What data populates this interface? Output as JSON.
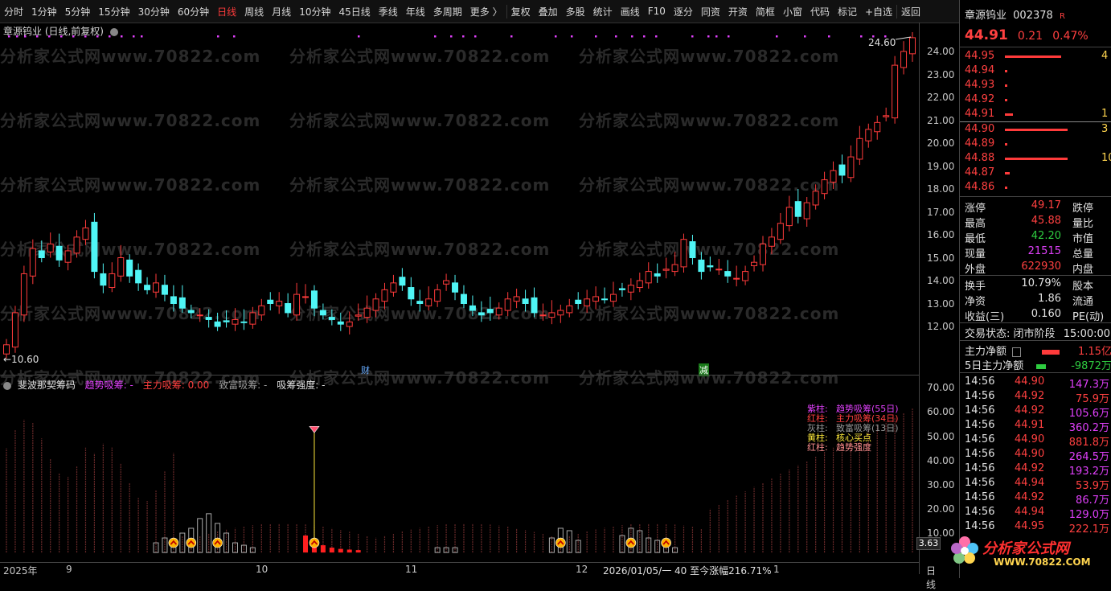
{
  "toolbar": {
    "items": [
      "分时",
      "1分钟",
      "5分钟",
      "15分钟",
      "30分钟",
      "60分钟",
      "日线",
      "周线",
      "月线",
      "10分钟",
      "45日线",
      "季线",
      "年线",
      "多周期",
      "更多 〉",
      "复权",
      "叠加",
      "多股",
      "统计",
      "画线",
      "F10",
      "逐分",
      "同资",
      "开资",
      "简框",
      "小窗",
      "代码",
      "标记",
      "+自选",
      "返回"
    ],
    "active": "日线"
  },
  "main": {
    "title": "章源钨业 (日线,前复权)",
    "high_label": "24.60",
    "low_label": "←10.60",
    "price_ticks": [
      "24.00",
      "23.00",
      "22.00",
      "21.00",
      "20.00",
      "19.00",
      "18.00",
      "17.00",
      "16.00",
      "15.00",
      "14.00",
      "13.00",
      "12.00"
    ],
    "marker_cai": "财",
    "marker_jian": "减",
    "watermark": "分析家公式网www.70822.com"
  },
  "osc": {
    "name": "斐波那契筹码",
    "f1_label": "趋势吸筹:",
    "f1_value": "-",
    "f2_label": "主力吸筹:",
    "f2_value": "0.00",
    "f3_label": "致富吸筹:",
    "f3_value": "-",
    "f4_label": "吸筹强度:",
    "f4_value": "-",
    "ticks": [
      "70.00",
      "60.00",
      "50.00",
      "40.00",
      "30.00",
      "20.00",
      "10.00"
    ],
    "value_box": "3.63",
    "legend": [
      {
        "k": "紫柱:",
        "v": "趋势吸筹(55日)",
        "color": "#e040fb"
      },
      {
        "k": "红柱:",
        "v": "主力吸筹(34日)",
        "color": "#ff4040"
      },
      {
        "k": "灰柱:",
        "v": "致富吸筹(13日)",
        "color": "#9a9a9a"
      },
      {
        "k": "黄柱:",
        "v": "核心买点",
        "color": "#ffeb3b"
      },
      {
        "k": "红柱:",
        "v": "趋势强度",
        "color": "#ff9090"
      }
    ]
  },
  "bottom_axis": {
    "labels": [
      "2025年",
      "9",
      "10",
      "11",
      "12",
      "1",
      "日线"
    ],
    "status": "2026/01/05/一  40  至今涨幅216.71%"
  },
  "panel": {
    "stock_name": "章源钨业",
    "code": "002378",
    "tag": "R",
    "price": "44.91",
    "change": "0.21",
    "change_pct": "0.47%",
    "asks": [
      {
        "p": "44.95",
        "v": "4"
      },
      {
        "p": "44.94",
        "v": ""
      },
      {
        "p": "44.93",
        "v": ""
      },
      {
        "p": "44.92",
        "v": ""
      },
      {
        "p": "44.91",
        "v": "1"
      }
    ],
    "bids": [
      {
        "p": "44.90",
        "v": "3"
      },
      {
        "p": "44.89",
        "v": ""
      },
      {
        "p": "44.88",
        "v": "10"
      },
      {
        "p": "44.87",
        "v": ""
      },
      {
        "p": "44.86",
        "v": ""
      }
    ],
    "stats": [
      {
        "k": "涨停",
        "v": "49.17",
        "vc": "red",
        "k2": "跌停"
      },
      {
        "k": "最高",
        "v": "45.88",
        "vc": "red",
        "k2": "量比"
      },
      {
        "k": "最低",
        "v": "42.20",
        "vc": "green",
        "k2": "市值"
      },
      {
        "k": "现量",
        "v": "21515",
        "vc": "magenta",
        "k2": "总量"
      },
      {
        "k": "外盘",
        "v": "622930",
        "vc": "red",
        "k2": "内盘"
      }
    ],
    "stats2": [
      {
        "k": "换手",
        "v": "10.79%",
        "k2": "股本"
      },
      {
        "k": "净资",
        "v": "1.86",
        "k2": "流通"
      },
      {
        "k": "收益(三)",
        "v": "0.160",
        "k2": "PE(动)"
      }
    ],
    "trade_status_label": "交易状态:",
    "trade_status": "闭市阶段",
    "trade_time": "15:00:00",
    "net_main_label": "主力净额",
    "net_main": "1.15亿",
    "net5_label": "5日主力净额",
    "net5": "-9872万",
    "ticks_list": [
      {
        "t": "14:56",
        "p": "44.90",
        "v": "147.3万"
      },
      {
        "t": "14:56",
        "p": "44.92",
        "v": "75.9万"
      },
      {
        "t": "14:56",
        "p": "44.92",
        "v": "105.6万"
      },
      {
        "t": "14:56",
        "p": "44.91",
        "v": "360.2万"
      },
      {
        "t": "14:56",
        "p": "44.90",
        "v": "881.8万"
      },
      {
        "t": "14:56",
        "p": "44.90",
        "v": "264.5万"
      },
      {
        "t": "14:56",
        "p": "44.92",
        "v": "193.2万"
      },
      {
        "t": "14:56",
        "p": "44.94",
        "v": "53.9万"
      },
      {
        "t": "14:56",
        "p": "44.92",
        "v": "86.7万"
      },
      {
        "t": "14:56",
        "p": "44.94",
        "v": "129.0万"
      },
      {
        "t": "14:56",
        "p": "44.95",
        "v": "222.1万"
      }
    ],
    "logo_text": "分析家公式网",
    "logo_url": "WWW.70822.COM"
  },
  "colors": {
    "up": "#ff3b3b",
    "down": "#4ff5f5",
    "bg": "#000000",
    "accent": "#ff3b3b"
  }
}
